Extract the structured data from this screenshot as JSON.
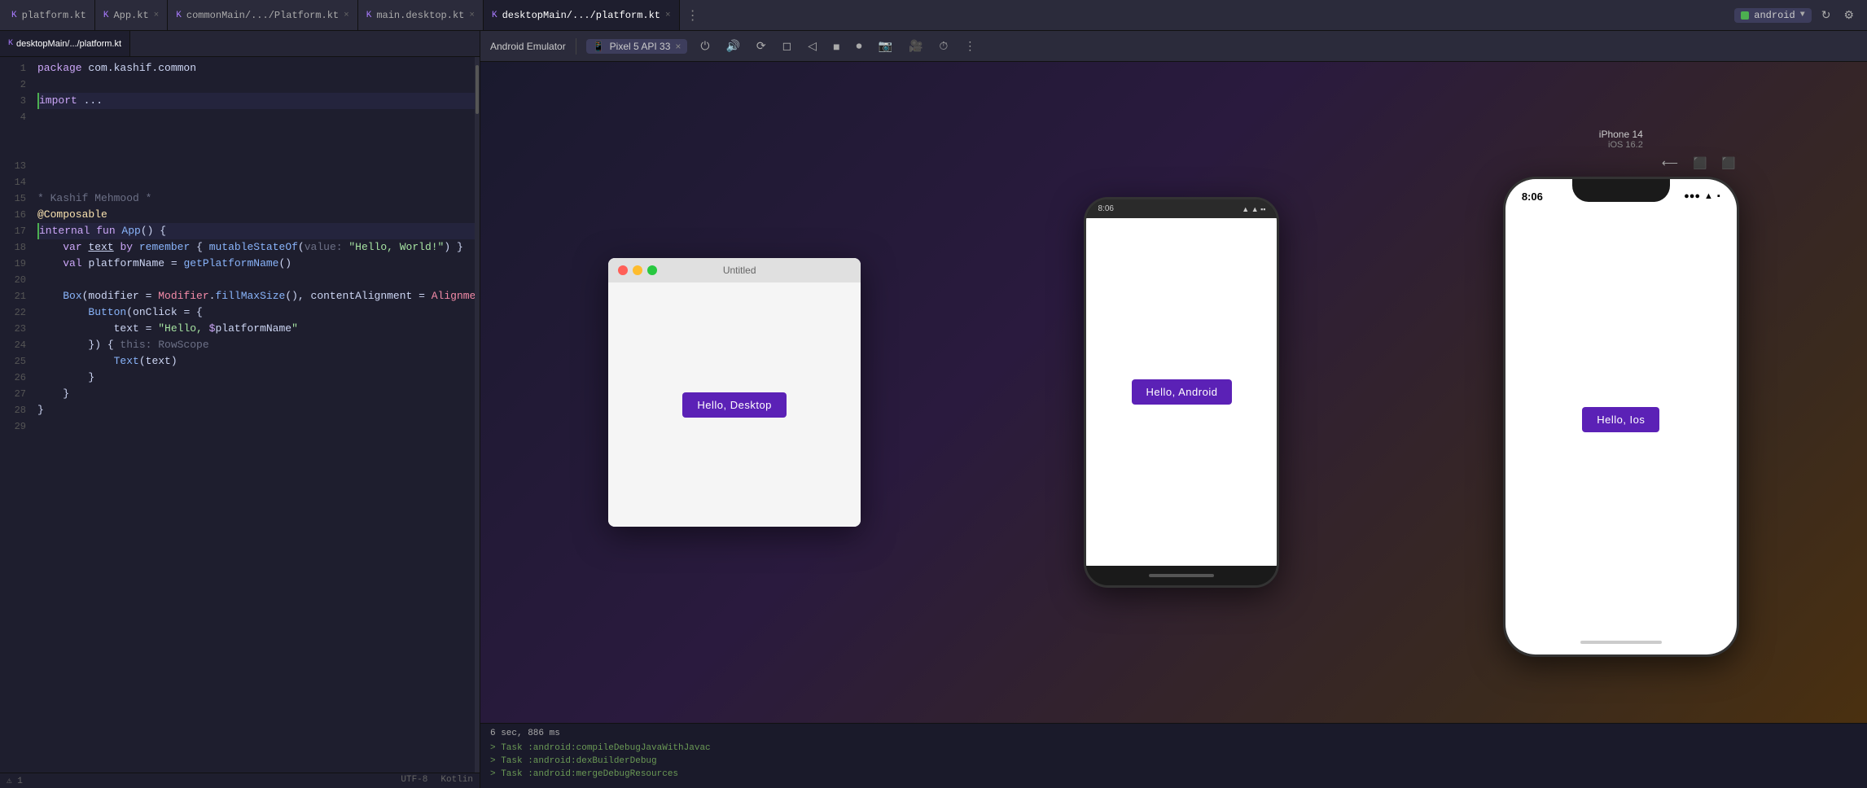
{
  "tabs": [
    {
      "label": "platform.kt",
      "icon": "kt",
      "active": false,
      "closable": false
    },
    {
      "label": "App.kt",
      "icon": "kt",
      "active": false,
      "closable": true
    },
    {
      "label": "commonMain/.../Platform.kt",
      "icon": "kt",
      "active": false,
      "closable": true
    },
    {
      "label": "main.desktop.kt",
      "icon": "kt",
      "active": false,
      "closable": true
    },
    {
      "label": "desktopMain/.../platform.kt",
      "icon": "kt",
      "active": true,
      "closable": true
    }
  ],
  "run_bar": {
    "indicator_color": "#4caf50",
    "app_label": "android",
    "refresh_icon": "↻",
    "settings_icon": "⚙"
  },
  "code": {
    "package_line": "package com.kashif.common",
    "lines": [
      {
        "num": 1,
        "content": ""
      },
      {
        "num": 2,
        "content": ""
      },
      {
        "num": 3,
        "content": "import ...",
        "highlight": true
      },
      {
        "num": 4,
        "content": ""
      },
      {
        "num": 13,
        "content": ""
      },
      {
        "num": 14,
        "content": ""
      },
      {
        "num": 15,
        "content": "* Kashif Mehmood *"
      },
      {
        "num": 16,
        "content": "@Composable"
      },
      {
        "num": 17,
        "content": "internal fun App() {",
        "highlight": true
      },
      {
        "num": 18,
        "content": "    var text by remember { mutableStateOf(value: \"Hello, World!\") }"
      },
      {
        "num": 19,
        "content": "    val platformName = getPlatformName()"
      },
      {
        "num": 20,
        "content": ""
      },
      {
        "num": 21,
        "content": "    Box(modifier = Modifier.fillMaxSize(), contentAlignment = Alignment.Cente"
      },
      {
        "num": 22,
        "content": "        Button(onClick = {"
      },
      {
        "num": 23,
        "content": "            text = \"Hello, $platformName\""
      },
      {
        "num": 24,
        "content": "        }) { this: RowScope"
      },
      {
        "num": 25,
        "content": "            Text(text)"
      },
      {
        "num": 26,
        "content": "        }"
      },
      {
        "num": 27,
        "content": "    }"
      },
      {
        "num": 28,
        "content": "}"
      },
      {
        "num": 29,
        "content": ""
      }
    ]
  },
  "emulator": {
    "label": "Android Emulator",
    "device": "Pixel 5 API 33",
    "icons": [
      "⏻",
      "🔊",
      "📷",
      "⬛",
      "◼",
      "⬟",
      "▣",
      "⏺",
      "⏹",
      "🎥",
      "⏱",
      "⋮"
    ]
  },
  "desktop_window": {
    "title": "Untitled",
    "button_label": "Hello, Desktop"
  },
  "android_phone": {
    "time": "8:06",
    "signal": "▲",
    "wifi": "▲",
    "battery": "▪",
    "button_label": "Hello, Android"
  },
  "ios_phone": {
    "time": "8:06",
    "signal_bars": "●●●",
    "wifi": "▲",
    "battery": "▪",
    "button_label": "Hello, Ios",
    "toolbar": {
      "icons": [
        "⬅",
        "⬛",
        "⬛"
      ]
    },
    "model_label": "iPhone 14",
    "os_label": "iOS 16.2"
  },
  "bottom_bar": {
    "time": "6 sec, 886 ms",
    "lines": [
      "> Task :android:compileDebugJavaWithJavac",
      "> Task :android:dexBuilderDebug",
      "> Task :android:mergeDebugResources"
    ]
  }
}
